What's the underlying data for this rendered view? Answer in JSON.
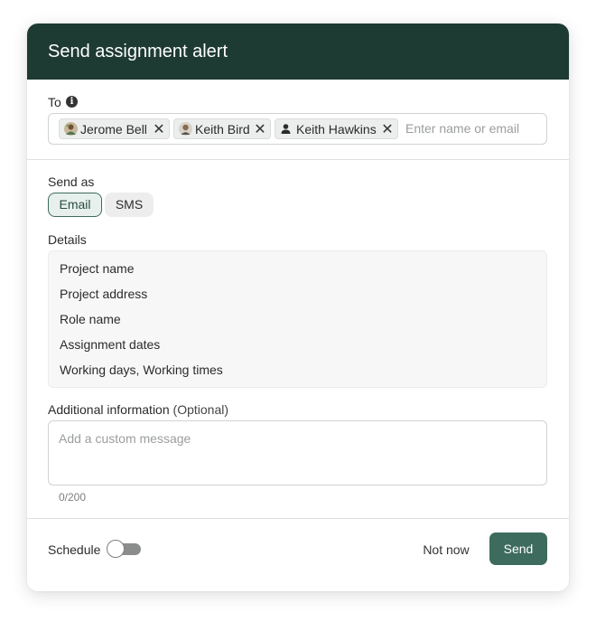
{
  "dialog": {
    "title": "Send assignment alert"
  },
  "to": {
    "label": "To",
    "info_icon": "info-icon",
    "recipients": [
      {
        "name": "Jerome Bell",
        "avatar": "photo-avatar"
      },
      {
        "name": "Keith Bird",
        "avatar": "photo-avatar"
      },
      {
        "name": "Keith Hawkins",
        "avatar": "person-icon"
      }
    ],
    "remove_icon": "close-icon",
    "placeholder": "Enter name or email"
  },
  "send_as": {
    "label": "Send as",
    "options": [
      "Email",
      "SMS"
    ],
    "selected": "Email"
  },
  "details": {
    "label": "Details",
    "items": [
      "Project name",
      "Project address",
      "Role name",
      "Assignment dates",
      "Working days, Working times"
    ]
  },
  "additional": {
    "label": "Additional information",
    "optional_label": "(Optional)",
    "placeholder": "Add a custom message",
    "counter": "0/200"
  },
  "footer": {
    "schedule_label": "Schedule",
    "schedule_enabled": false,
    "not_now_label": "Not now",
    "send_label": "Send"
  },
  "colors": {
    "header_bg": "#1d3a33",
    "accent": "#3d6b5e",
    "selected_bg": "#e7f0ec"
  }
}
